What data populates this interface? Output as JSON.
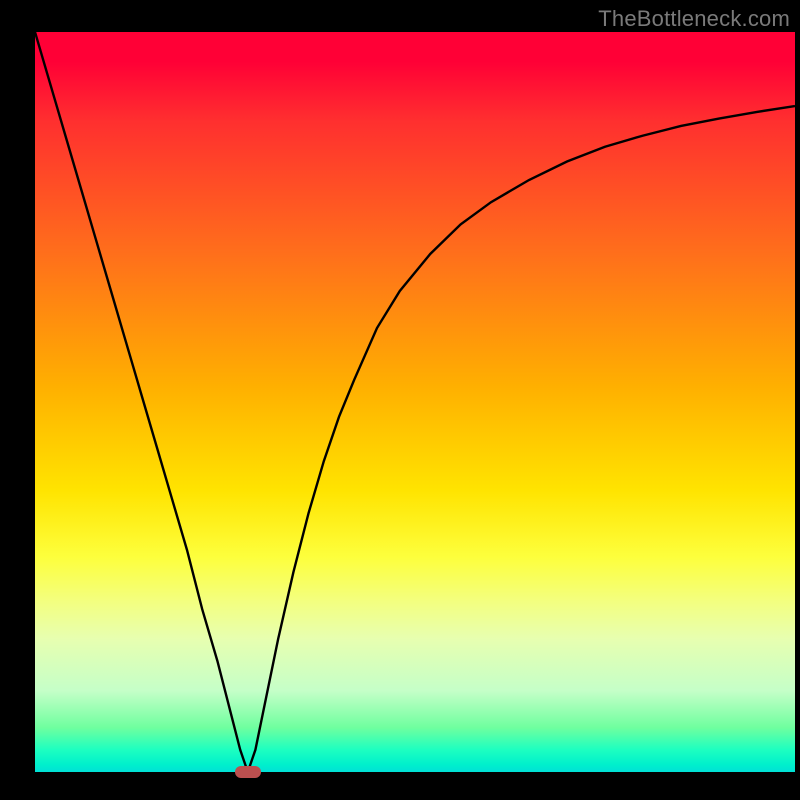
{
  "watermark": "TheBottleneck.com",
  "colors": {
    "background": "#000000",
    "marker": "#bb4f4f",
    "curve": "#000000"
  },
  "chart_data": {
    "type": "line",
    "title": "",
    "xlabel": "",
    "ylabel": "",
    "xlim": [
      0,
      100
    ],
    "ylim": [
      0,
      100
    ],
    "grid": false,
    "legend": false,
    "x": [
      0,
      2,
      4,
      6,
      8,
      10,
      12,
      14,
      16,
      18,
      20,
      22,
      24,
      26,
      27,
      28,
      29,
      30,
      32,
      34,
      36,
      38,
      40,
      42,
      45,
      48,
      52,
      56,
      60,
      65,
      70,
      75,
      80,
      85,
      90,
      95,
      100
    ],
    "values": [
      100,
      93,
      86,
      79,
      72,
      65,
      58,
      51,
      44,
      37,
      30,
      22,
      15,
      7,
      3,
      0,
      3,
      8,
      18,
      27,
      35,
      42,
      48,
      53,
      60,
      65,
      70,
      74,
      77,
      80,
      82.5,
      84.5,
      86,
      87.3,
      88.3,
      89.2,
      90
    ],
    "marker": {
      "x": 28,
      "y": 0
    },
    "annotations": []
  }
}
